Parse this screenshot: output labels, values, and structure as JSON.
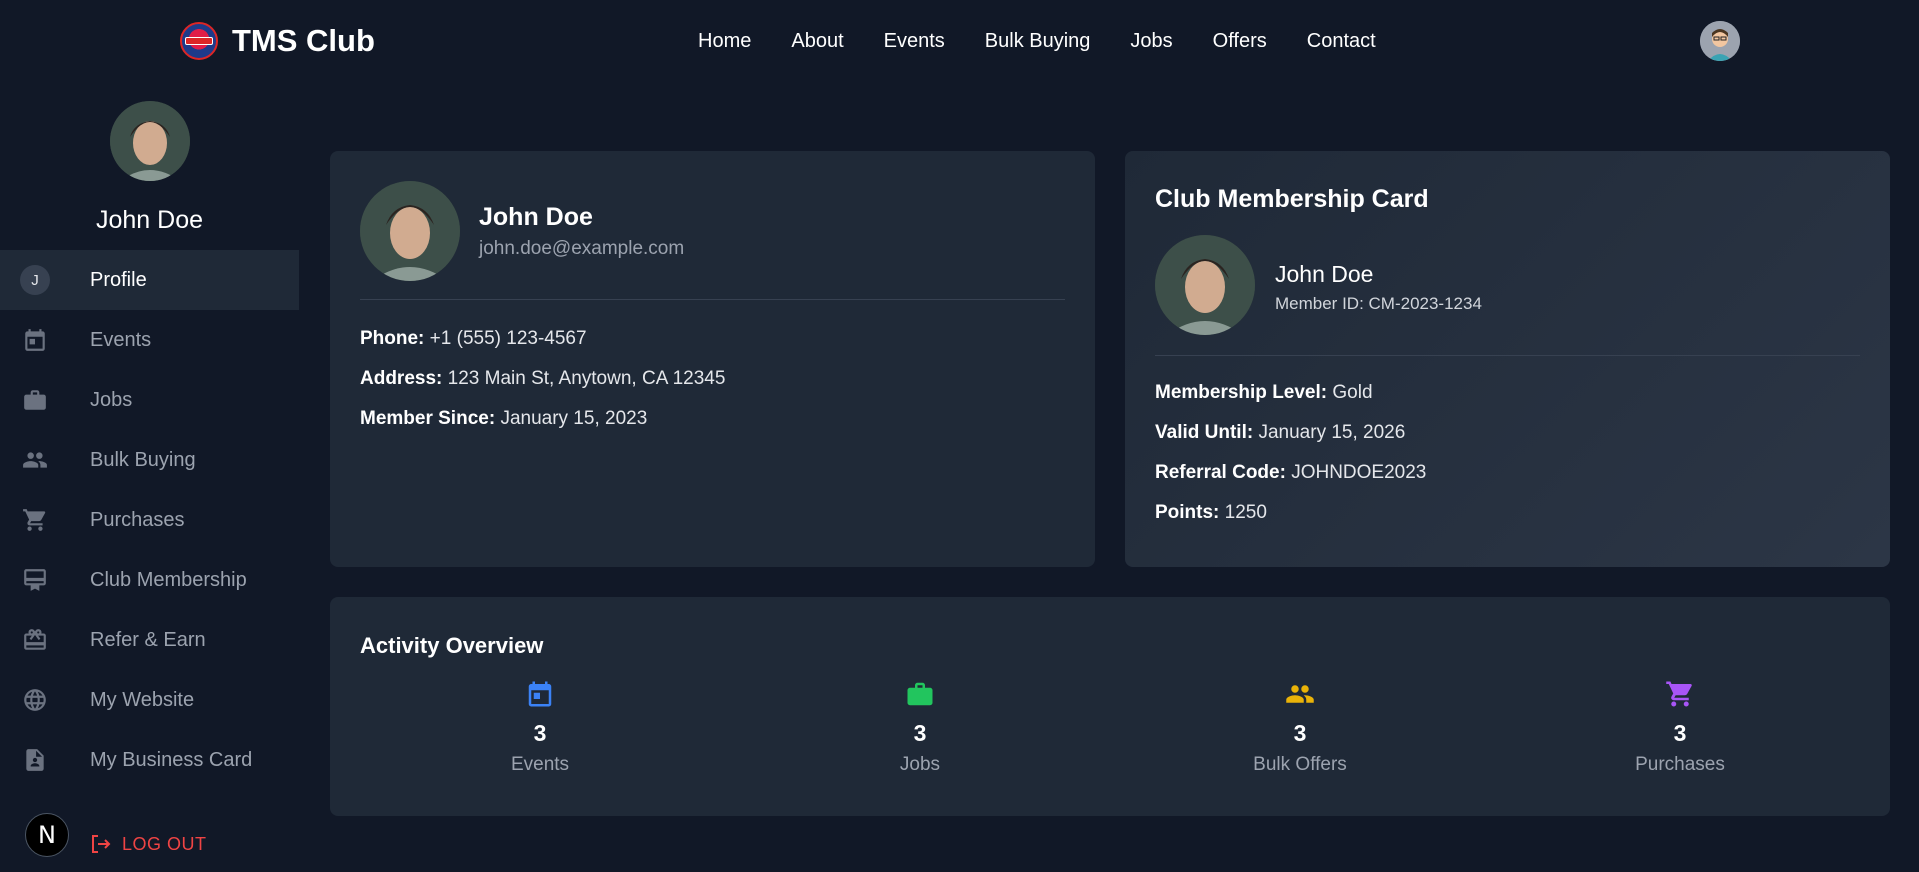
{
  "brand": {
    "name": "TMS Club"
  },
  "nav": [
    "Home",
    "About",
    "Events",
    "Bulk Buying",
    "Jobs",
    "Offers",
    "Contact"
  ],
  "sidebar": {
    "user_name": "John Doe",
    "items": [
      {
        "label": "Profile",
        "icon": "avatar-initial-icon",
        "initial": "J"
      },
      {
        "label": "Events",
        "icon": "calendar-icon"
      },
      {
        "label": "Jobs",
        "icon": "briefcase-icon"
      },
      {
        "label": "Bulk Buying",
        "icon": "people-icon"
      },
      {
        "label": "Purchases",
        "icon": "cart-icon"
      },
      {
        "label": "Club Membership",
        "icon": "membership-icon"
      },
      {
        "label": "Refer & Earn",
        "icon": "gift-card-icon"
      },
      {
        "label": "My Website",
        "icon": "globe-icon"
      },
      {
        "label": "My Business Card",
        "icon": "contact-card-icon"
      }
    ],
    "logout": "LOG OUT",
    "badge": "N"
  },
  "profile": {
    "name": "John Doe",
    "email": "john.doe@example.com",
    "phone_label": "Phone:",
    "phone": "+1 (555) 123-4567",
    "address_label": "Address:",
    "address": "123 Main St, Anytown, CA 12345",
    "since_label": "Member Since:",
    "since": "January 15, 2023"
  },
  "membership": {
    "title": "Club Membership Card",
    "name": "John Doe",
    "member_id": "Member ID: CM-2023-1234",
    "level_label": "Membership Level:",
    "level": "Gold",
    "valid_label": "Valid Until:",
    "valid": "January 15, 2026",
    "referral_label": "Referral Code:",
    "referral": "JOHNDOE2023",
    "points_label": "Points:",
    "points": "1250"
  },
  "activity": {
    "title": "Activity Overview",
    "stats": [
      {
        "value": "3",
        "label": "Events",
        "icon": "calendar-icon",
        "color": "#3b82f6"
      },
      {
        "value": "3",
        "label": "Jobs",
        "icon": "briefcase-icon",
        "color": "#22c55e"
      },
      {
        "value": "3",
        "label": "Bulk Offers",
        "icon": "people-icon",
        "color": "#eab308"
      },
      {
        "value": "3",
        "label": "Purchases",
        "icon": "cart-icon",
        "color": "#a855f7"
      }
    ]
  },
  "colors": {
    "background": "#111827",
    "card": "#1f2937",
    "active": "#1f2937",
    "logout": "#ef4444"
  }
}
